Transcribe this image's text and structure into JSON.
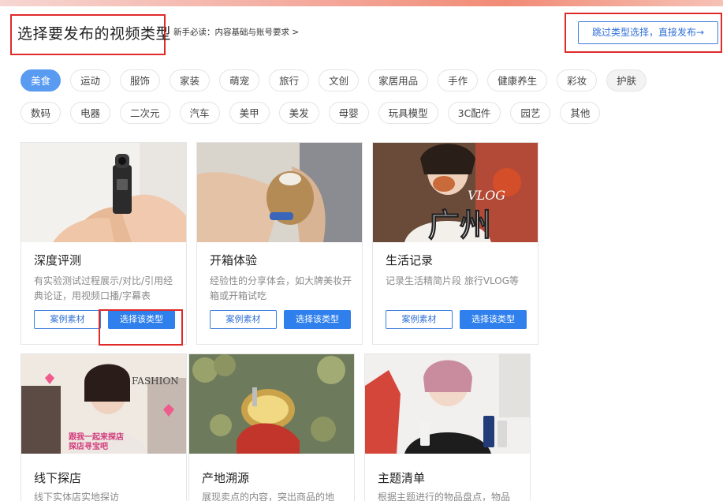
{
  "header": {
    "title": "选择要发布的视频类型",
    "guide_link": "新手必读：内容基础与账号要求 >",
    "skip_button": "跳过类型选择，直接发布→"
  },
  "tags_row1": [
    "美食",
    "运动",
    "服饰",
    "家装",
    "萌宠",
    "旅行",
    "文创",
    "家居用品",
    "手作",
    "健康养生",
    "彩妆",
    "护肤"
  ],
  "tags_row2": [
    "数码",
    "电器",
    "二次元",
    "汽车",
    "美甲",
    "美发",
    "母婴",
    "玩具模型",
    "3C配件",
    "园艺",
    "其他"
  ],
  "active_tag": "美食",
  "cards": [
    {
      "title": "深度评测",
      "desc": "有实验测试过程展示/对比/引用经典论证，用视频口播/字幕表",
      "case_label": "案例素材",
      "select_label": "选择该类型"
    },
    {
      "title": "开箱体验",
      "desc": "经验性的分享体会，如大牌美妆开箱或开箱试吃",
      "case_label": "案例素材",
      "select_label": "选择该类型"
    },
    {
      "title": "生活记录",
      "desc": "记录生活精简片段 旅行VLOG等",
      "case_label": "案例素材",
      "select_label": "选择该类型"
    },
    {
      "title": "线下探店",
      "desc": "线下实体店实地探访"
    },
    {
      "title": "产地溯源",
      "desc": "展现卖点的内容，突出商品的地"
    },
    {
      "title": "主题清单",
      "desc": "根据主题进行的物品盘点，物品"
    }
  ],
  "overlay_text": {
    "vlog": "VLOG",
    "guangzhou": "广州",
    "fashion": "FASHION",
    "shop_caption": "跟我一起来探店\n探店寻宝吧"
  },
  "colors": {
    "accent": "#2f80ed",
    "highlight": "#e02a2a",
    "active_tag": "#5a9bf2"
  }
}
